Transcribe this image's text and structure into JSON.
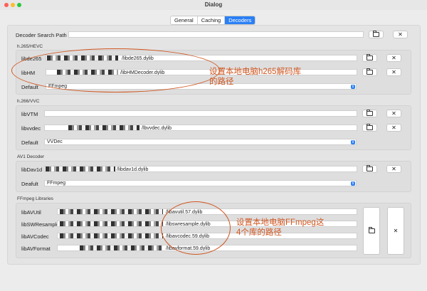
{
  "window": {
    "title": "Dialog"
  },
  "tabs": [
    {
      "label": "General",
      "active": false
    },
    {
      "label": "Caching",
      "active": false
    },
    {
      "label": "Decoders",
      "active": true
    }
  ],
  "search_path": {
    "label": "Decoder Search Path",
    "value": ""
  },
  "hevc": {
    "title": "h.265/HEVC",
    "libde265": {
      "label": "libde265",
      "value": "/libde265.dylib"
    },
    "libhm": {
      "label": "libHM",
      "value": "/libHMDecoder.dylib"
    },
    "default": {
      "label": "Default",
      "value": "FFmpeg"
    }
  },
  "vvc": {
    "title": "h.266/VVC",
    "libvtm": {
      "label": "libVTM",
      "value": ""
    },
    "libvvdec": {
      "label": "libvvdec",
      "value": "/lbvvdec.dylib"
    },
    "default": {
      "label": "Default",
      "value": "VVDec"
    }
  },
  "av1": {
    "title": "AV1 Decoder",
    "libdav1d": {
      "label": "libDav1d",
      "value": "/libdav1d.dylib"
    },
    "default": {
      "label": "Deafult",
      "value": "FFmpeg"
    }
  },
  "ffmpeg": {
    "title": "FFmpeg Libraries",
    "libavutil": {
      "label": "libAVUtil",
      "value": "/libavutil.57.dylib"
    },
    "libswresample": {
      "label": "libSWResample",
      "value": "/libswresample.dylib"
    },
    "libavcodec": {
      "label": "libAVCodec",
      "value": "/libavcodec.59.dylib"
    },
    "libavformat": {
      "label": "libAVFormat",
      "value": "/libavformat.59.dylib"
    }
  },
  "buttons": {
    "clear": "✕"
  },
  "annotations": {
    "h265_line1": "设置本地电脑h265解码库",
    "h265_line2": "的路径",
    "ffmpeg_line1": "设置本地电脑FFmpeg这",
    "ffmpeg_line2": "4个库的路径"
  },
  "colors": {
    "accent": "#2a7ff5",
    "annotation": "#d0551f"
  }
}
